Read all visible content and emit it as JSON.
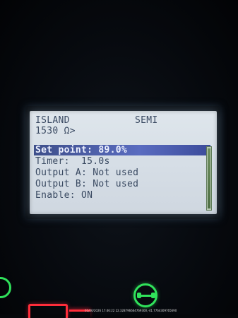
{
  "lcd": {
    "header_left": "ISLAND",
    "header_right": "SEMI",
    "header_sub": "1530 Ω>",
    "rows": [
      {
        "label": "Set point:",
        "value": "89.0%"
      },
      {
        "label": "Timer:",
        "value": "15.0s"
      },
      {
        "label": "Output A:",
        "value": "Not used"
      },
      {
        "label": "Output B:",
        "value": "Not used"
      },
      {
        "label": "Enable:",
        "value": "ON"
      }
    ],
    "selected_row": 0
  },
  "colors": {
    "lcd_background": "#d6dee6",
    "lcd_text": "#3a4a62",
    "highlight": "#5a6cc0",
    "indicator_green": "#30e35b",
    "indicator_red": "#ff2d3a"
  },
  "watermark": "01/06/2026 17:46:22 22.328796664769300,-41.7764309765690"
}
